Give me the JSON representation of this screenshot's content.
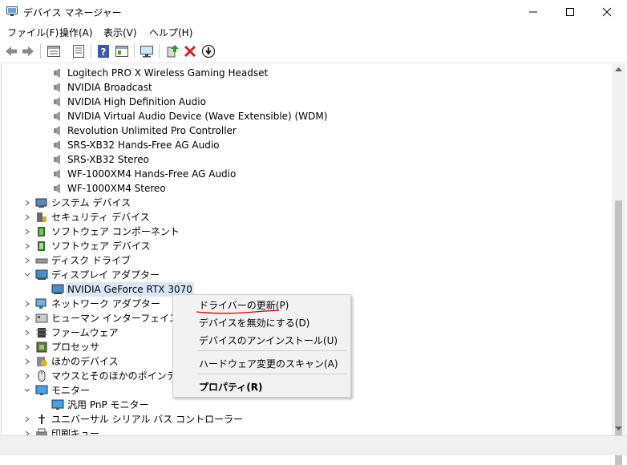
{
  "window": {
    "title": "デバイス マネージャー"
  },
  "menu": [
    {
      "label": "ファイル(F)"
    },
    {
      "label": "操作(A)"
    },
    {
      "label": "表示(V)"
    },
    {
      "label": "ヘルプ(H)"
    }
  ],
  "toolbar": {
    "icons": [
      "back-icon",
      "forward-icon",
      "properties-view-icon",
      "device-list-icon",
      "help-icon",
      "console-tree-icon",
      "monitor-scan-icon",
      "update-driver-icon",
      "uninstall-icon",
      "install-icon"
    ]
  },
  "tree": {
    "audio_devices": [
      "Logitech PRO X Wireless Gaming Headset",
      "NVIDIA Broadcast",
      "NVIDIA High Definition Audio",
      "NVIDIA Virtual Audio Device (Wave Extensible) (WDM)",
      "Revolution Unlimited Pro Controller",
      "SRS-XB32 Hands-Free AG Audio",
      "SRS-XB32 Stereo",
      "WF-1000XM4 Hands-Free AG Audio",
      "WF-1000XM4 Stereo"
    ],
    "categories": {
      "system": "システム デバイス",
      "security": "セキュリティ デバイス",
      "sw_component": "ソフトウェア コンポーネント",
      "sw_device": "ソフトウェア デバイス",
      "disk": "ディスク ドライブ",
      "display": "ディスプレイ アダプター",
      "gpu": "NVIDIA GeForce RTX 3070",
      "network": "ネットワーク アダプター",
      "hid": "ヒューマン インターフェイス デバイス",
      "firmware": "ファームウェア",
      "processor": "プロセッサ",
      "other": "ほかのデバイス",
      "mouse": "マウスとそのほかのポインティング",
      "monitor": "モニター",
      "pnp_monitor": "汎用 PnP モニター",
      "usb": "ユニバーサル シリアル バス コントローラー",
      "print_queue": "印刷キュー"
    }
  },
  "context_menu": {
    "update_driver": "ドライバーの更新(P)",
    "disable_device": "デバイスを無効にする(D)",
    "uninstall_device": "デバイスのアンインストール(U)",
    "scan_hardware": "ハードウェア変更のスキャン(A)",
    "properties": "プロパティ(R)"
  },
  "colors": {
    "annotation_underline": "#e00000",
    "selection": "#d9e8f7"
  }
}
